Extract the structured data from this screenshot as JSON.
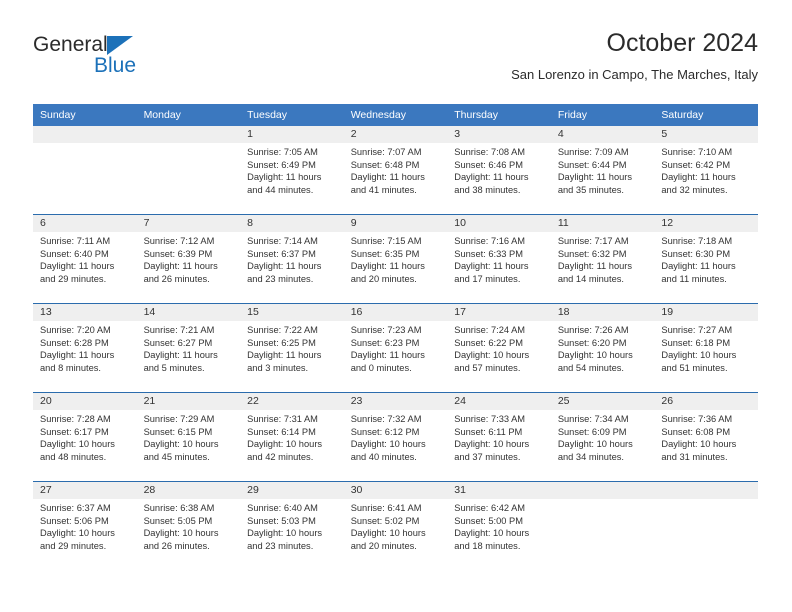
{
  "brand": {
    "line1": "General",
    "line2": "Blue",
    "triangle_color": "#1c71b9"
  },
  "header": {
    "title": "October 2024",
    "subtitle": "San Lorenzo in Campo, The Marches, Italy"
  },
  "colors": {
    "header_blue": "#3b78bf",
    "row_divider_blue": "#2b6cad",
    "daynum_band": "#efefef",
    "text": "#333333"
  },
  "calendar": {
    "weekday_headers": [
      "Sunday",
      "Monday",
      "Tuesday",
      "Wednesday",
      "Thursday",
      "Friday",
      "Saturday"
    ],
    "weeks": [
      [
        {
          "day": "",
          "sunrise": "",
          "sunset": "",
          "daylight": "",
          "empty": true
        },
        {
          "day": "",
          "sunrise": "",
          "sunset": "",
          "daylight": "",
          "empty": true
        },
        {
          "day": "1",
          "sunrise": "Sunrise: 7:05 AM",
          "sunset": "Sunset: 6:49 PM",
          "daylight": "Daylight: 11 hours and 44 minutes."
        },
        {
          "day": "2",
          "sunrise": "Sunrise: 7:07 AM",
          "sunset": "Sunset: 6:48 PM",
          "daylight": "Daylight: 11 hours and 41 minutes."
        },
        {
          "day": "3",
          "sunrise": "Sunrise: 7:08 AM",
          "sunset": "Sunset: 6:46 PM",
          "daylight": "Daylight: 11 hours and 38 minutes."
        },
        {
          "day": "4",
          "sunrise": "Sunrise: 7:09 AM",
          "sunset": "Sunset: 6:44 PM",
          "daylight": "Daylight: 11 hours and 35 minutes."
        },
        {
          "day": "5",
          "sunrise": "Sunrise: 7:10 AM",
          "sunset": "Sunset: 6:42 PM",
          "daylight": "Daylight: 11 hours and 32 minutes."
        }
      ],
      [
        {
          "day": "6",
          "sunrise": "Sunrise: 7:11 AM",
          "sunset": "Sunset: 6:40 PM",
          "daylight": "Daylight: 11 hours and 29 minutes."
        },
        {
          "day": "7",
          "sunrise": "Sunrise: 7:12 AM",
          "sunset": "Sunset: 6:39 PM",
          "daylight": "Daylight: 11 hours and 26 minutes."
        },
        {
          "day": "8",
          "sunrise": "Sunrise: 7:14 AM",
          "sunset": "Sunset: 6:37 PM",
          "daylight": "Daylight: 11 hours and 23 minutes."
        },
        {
          "day": "9",
          "sunrise": "Sunrise: 7:15 AM",
          "sunset": "Sunset: 6:35 PM",
          "daylight": "Daylight: 11 hours and 20 minutes."
        },
        {
          "day": "10",
          "sunrise": "Sunrise: 7:16 AM",
          "sunset": "Sunset: 6:33 PM",
          "daylight": "Daylight: 11 hours and 17 minutes."
        },
        {
          "day": "11",
          "sunrise": "Sunrise: 7:17 AM",
          "sunset": "Sunset: 6:32 PM",
          "daylight": "Daylight: 11 hours and 14 minutes."
        },
        {
          "day": "12",
          "sunrise": "Sunrise: 7:18 AM",
          "sunset": "Sunset: 6:30 PM",
          "daylight": "Daylight: 11 hours and 11 minutes."
        }
      ],
      [
        {
          "day": "13",
          "sunrise": "Sunrise: 7:20 AM",
          "sunset": "Sunset: 6:28 PM",
          "daylight": "Daylight: 11 hours and 8 minutes."
        },
        {
          "day": "14",
          "sunrise": "Sunrise: 7:21 AM",
          "sunset": "Sunset: 6:27 PM",
          "daylight": "Daylight: 11 hours and 5 minutes."
        },
        {
          "day": "15",
          "sunrise": "Sunrise: 7:22 AM",
          "sunset": "Sunset: 6:25 PM",
          "daylight": "Daylight: 11 hours and 3 minutes."
        },
        {
          "day": "16",
          "sunrise": "Sunrise: 7:23 AM",
          "sunset": "Sunset: 6:23 PM",
          "daylight": "Daylight: 11 hours and 0 minutes."
        },
        {
          "day": "17",
          "sunrise": "Sunrise: 7:24 AM",
          "sunset": "Sunset: 6:22 PM",
          "daylight": "Daylight: 10 hours and 57 minutes."
        },
        {
          "day": "18",
          "sunrise": "Sunrise: 7:26 AM",
          "sunset": "Sunset: 6:20 PM",
          "daylight": "Daylight: 10 hours and 54 minutes."
        },
        {
          "day": "19",
          "sunrise": "Sunrise: 7:27 AM",
          "sunset": "Sunset: 6:18 PM",
          "daylight": "Daylight: 10 hours and 51 minutes."
        }
      ],
      [
        {
          "day": "20",
          "sunrise": "Sunrise: 7:28 AM",
          "sunset": "Sunset: 6:17 PM",
          "daylight": "Daylight: 10 hours and 48 minutes."
        },
        {
          "day": "21",
          "sunrise": "Sunrise: 7:29 AM",
          "sunset": "Sunset: 6:15 PM",
          "daylight": "Daylight: 10 hours and 45 minutes."
        },
        {
          "day": "22",
          "sunrise": "Sunrise: 7:31 AM",
          "sunset": "Sunset: 6:14 PM",
          "daylight": "Daylight: 10 hours and 42 minutes."
        },
        {
          "day": "23",
          "sunrise": "Sunrise: 7:32 AM",
          "sunset": "Sunset: 6:12 PM",
          "daylight": "Daylight: 10 hours and 40 minutes."
        },
        {
          "day": "24",
          "sunrise": "Sunrise: 7:33 AM",
          "sunset": "Sunset: 6:11 PM",
          "daylight": "Daylight: 10 hours and 37 minutes."
        },
        {
          "day": "25",
          "sunrise": "Sunrise: 7:34 AM",
          "sunset": "Sunset: 6:09 PM",
          "daylight": "Daylight: 10 hours and 34 minutes."
        },
        {
          "day": "26",
          "sunrise": "Sunrise: 7:36 AM",
          "sunset": "Sunset: 6:08 PM",
          "daylight": "Daylight: 10 hours and 31 minutes."
        }
      ],
      [
        {
          "day": "27",
          "sunrise": "Sunrise: 6:37 AM",
          "sunset": "Sunset: 5:06 PM",
          "daylight": "Daylight: 10 hours and 29 minutes."
        },
        {
          "day": "28",
          "sunrise": "Sunrise: 6:38 AM",
          "sunset": "Sunset: 5:05 PM",
          "daylight": "Daylight: 10 hours and 26 minutes."
        },
        {
          "day": "29",
          "sunrise": "Sunrise: 6:40 AM",
          "sunset": "Sunset: 5:03 PM",
          "daylight": "Daylight: 10 hours and 23 minutes."
        },
        {
          "day": "30",
          "sunrise": "Sunrise: 6:41 AM",
          "sunset": "Sunset: 5:02 PM",
          "daylight": "Daylight: 10 hours and 20 minutes."
        },
        {
          "day": "31",
          "sunrise": "Sunrise: 6:42 AM",
          "sunset": "Sunset: 5:00 PM",
          "daylight": "Daylight: 10 hours and 18 minutes."
        },
        {
          "day": "",
          "sunrise": "",
          "sunset": "",
          "daylight": "",
          "empty": true
        },
        {
          "day": "",
          "sunrise": "",
          "sunset": "",
          "daylight": "",
          "empty": true
        }
      ]
    ]
  }
}
